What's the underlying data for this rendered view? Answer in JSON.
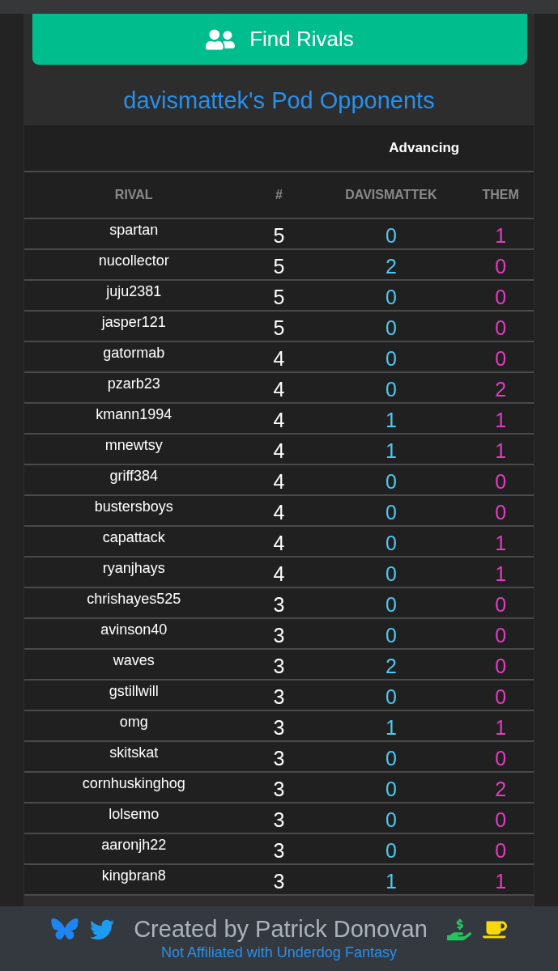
{
  "find_button": {
    "label": "Find Rivals"
  },
  "title": "davismattek's Pod Opponents",
  "table": {
    "group_header": "Advancing",
    "columns": [
      "RIVAL",
      "#",
      "DAVISMATTEK",
      "THEM"
    ],
    "rows": [
      {
        "rival": "spartan",
        "count": "5",
        "mine": "0",
        "them": "1"
      },
      {
        "rival": "nucollector",
        "count": "5",
        "mine": "2",
        "them": "0"
      },
      {
        "rival": "juju2381",
        "count": "5",
        "mine": "0",
        "them": "0"
      },
      {
        "rival": "jasper121",
        "count": "5",
        "mine": "0",
        "them": "0"
      },
      {
        "rival": "gatormab",
        "count": "4",
        "mine": "0",
        "them": "0"
      },
      {
        "rival": "pzarb23",
        "count": "4",
        "mine": "0",
        "them": "2"
      },
      {
        "rival": "kmann1994",
        "count": "4",
        "mine": "1",
        "them": "1"
      },
      {
        "rival": "mnewtsy",
        "count": "4",
        "mine": "1",
        "them": "1"
      },
      {
        "rival": "griff384",
        "count": "4",
        "mine": "0",
        "them": "0"
      },
      {
        "rival": "bustersboys",
        "count": "4",
        "mine": "0",
        "them": "0"
      },
      {
        "rival": "capattack",
        "count": "4",
        "mine": "0",
        "them": "1"
      },
      {
        "rival": "ryanjhays",
        "count": "4",
        "mine": "0",
        "them": "1"
      },
      {
        "rival": "chrishayes525",
        "count": "3",
        "mine": "0",
        "them": "0"
      },
      {
        "rival": "avinson40",
        "count": "3",
        "mine": "0",
        "them": "0"
      },
      {
        "rival": "waves",
        "count": "3",
        "mine": "2",
        "them": "0"
      },
      {
        "rival": "gstillwill",
        "count": "3",
        "mine": "0",
        "them": "0"
      },
      {
        "rival": "omg",
        "count": "3",
        "mine": "1",
        "them": "1"
      },
      {
        "rival": "skitskat",
        "count": "3",
        "mine": "0",
        "them": "0"
      },
      {
        "rival": "cornhuskinghog",
        "count": "3",
        "mine": "0",
        "them": "2"
      },
      {
        "rival": "lolsemo",
        "count": "3",
        "mine": "0",
        "them": "0"
      },
      {
        "rival": "aaronjh22",
        "count": "3",
        "mine": "0",
        "them": "0"
      },
      {
        "rival": "kingbran8",
        "count": "3",
        "mine": "1",
        "them": "1"
      }
    ]
  },
  "footer": {
    "credit": "Created by Patrick Donovan",
    "disclaimer": "Not Affiliated with Underdog Fantasy"
  }
}
